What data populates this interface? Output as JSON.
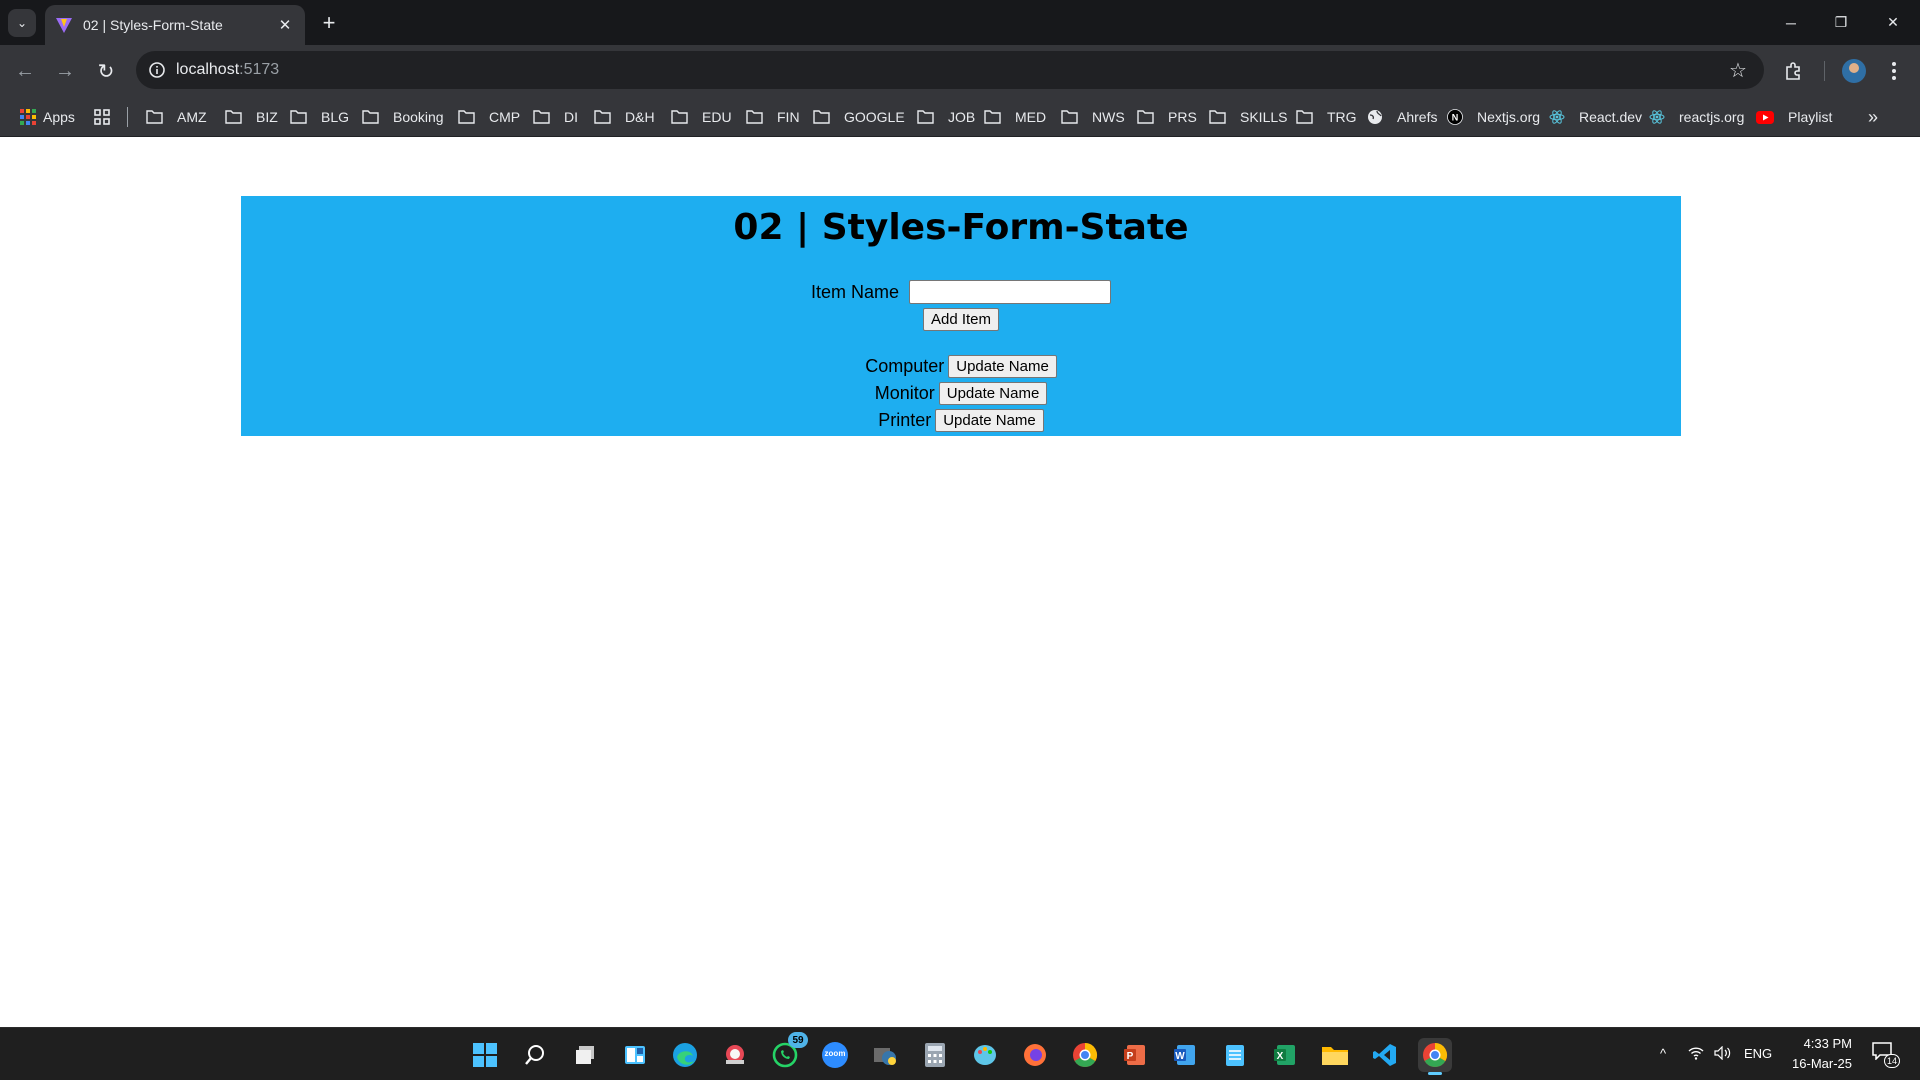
{
  "tab": {
    "title": "02 | Styles-Form-State",
    "close_label": "✕",
    "new_tab_label": "+"
  },
  "window": {
    "minimize": "─",
    "restore": "❐",
    "close": "✕"
  },
  "address_bar": {
    "host": "localhost",
    "port": ":5173"
  },
  "bookmarks": {
    "apps_label": "Apps",
    "items": [
      {
        "label": "AMZ",
        "icon": "folder-icon"
      },
      {
        "label": "BIZ",
        "icon": "folder-icon"
      },
      {
        "label": "BLG",
        "icon": "folder-icon"
      },
      {
        "label": "Booking",
        "icon": "folder-icon"
      },
      {
        "label": "CMP",
        "icon": "folder-icon"
      },
      {
        "label": "DI",
        "icon": "folder-icon"
      },
      {
        "label": "D&H",
        "icon": "folder-icon"
      },
      {
        "label": "EDU",
        "icon": "folder-icon"
      },
      {
        "label": "FIN",
        "icon": "folder-icon"
      },
      {
        "label": "GOOGLE",
        "icon": "folder-icon"
      },
      {
        "label": "JOB",
        "icon": "folder-icon"
      },
      {
        "label": "MED",
        "icon": "folder-icon"
      },
      {
        "label": "NWS",
        "icon": "folder-icon"
      },
      {
        "label": "PRS",
        "icon": "folder-icon"
      },
      {
        "label": "SKILLS",
        "icon": "folder-icon"
      },
      {
        "label": "TRG",
        "icon": "folder-icon"
      },
      {
        "label": "Ahrefs",
        "icon": "globe-icon"
      },
      {
        "label": "Nextjs.org",
        "icon": "nextjs-icon"
      },
      {
        "label": "React.dev",
        "icon": "react-icon"
      },
      {
        "label": "reactjs.org",
        "icon": "react-icon"
      },
      {
        "label": "Playlist",
        "icon": "youtube-icon"
      }
    ],
    "more_label": "»"
  },
  "app": {
    "title": "02 | Styles-Form-State",
    "form": {
      "label": "Item Name",
      "input_value": "",
      "add_button": "Add Item"
    },
    "items": [
      {
        "name": "Computer",
        "button": "Update Name"
      },
      {
        "name": "Monitor",
        "button": "Update Name"
      },
      {
        "name": "Printer",
        "button": "Update Name"
      }
    ]
  },
  "taskbar": {
    "whatsapp_badge": "59",
    "zoom_label": "zoom",
    "tray": {
      "language": "ENG",
      "time": "4:33 PM",
      "date": "16-Mar-25",
      "notifications": "14"
    }
  },
  "colors": {
    "app_background": "#1eaef0",
    "chrome_dark": "#35363a",
    "tabstrip": "#17181b"
  }
}
